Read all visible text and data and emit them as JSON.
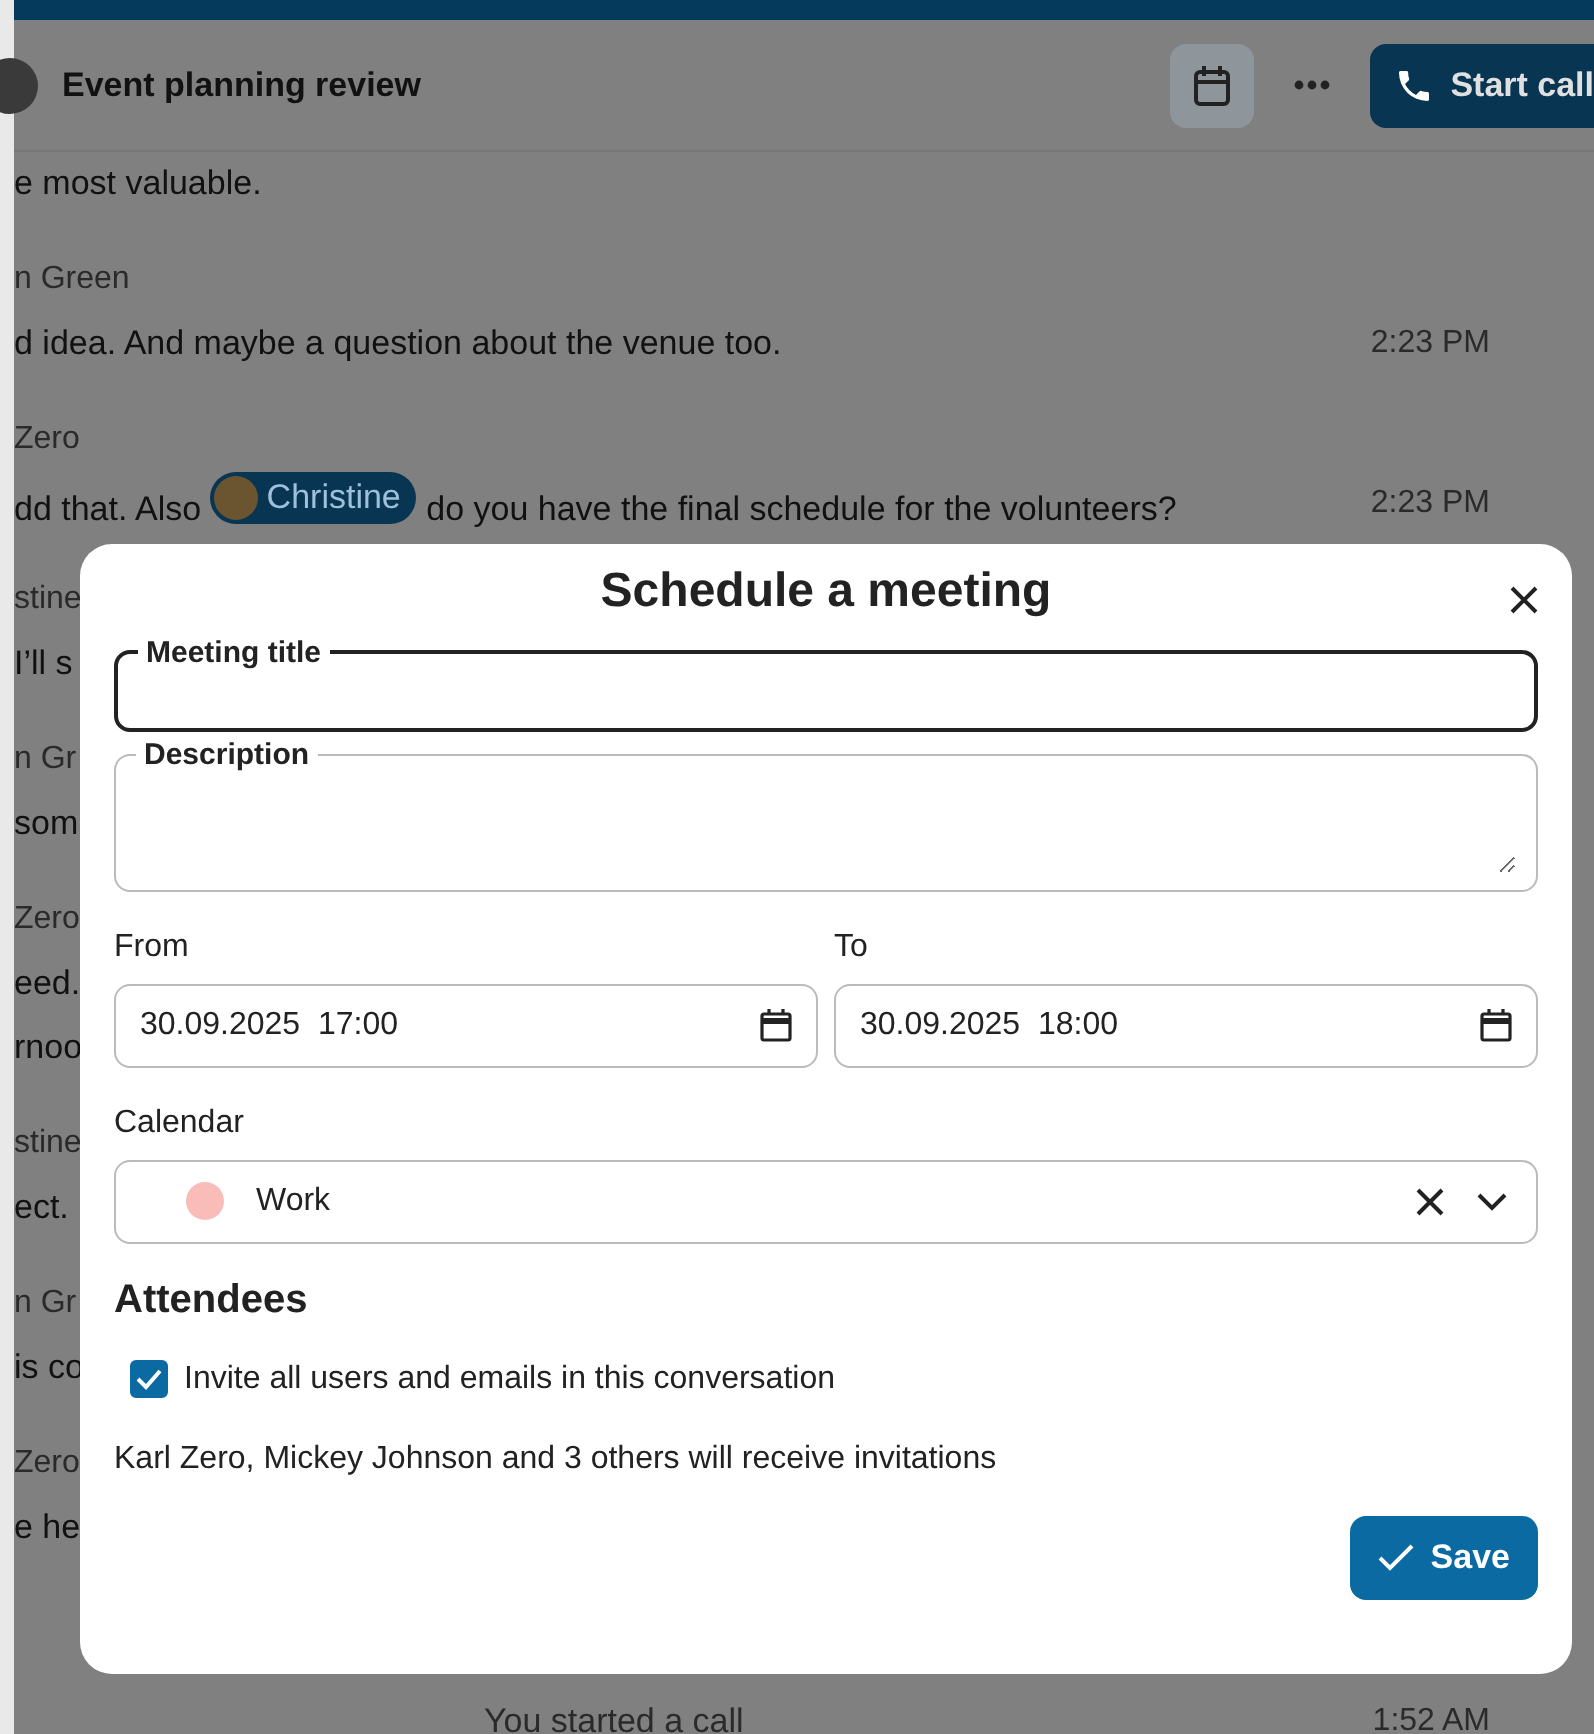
{
  "header": {
    "title": "Event planning review",
    "calendar_active": true,
    "start_call": "Start call"
  },
  "messages": [
    {
      "kind": "text",
      "text": "e most valuable."
    },
    {
      "kind": "author",
      "text": "n Green"
    },
    {
      "kind": "text",
      "text": "d idea. And maybe a question about the venue too.",
      "time": "2:23 PM"
    },
    {
      "kind": "author",
      "text": "Zero"
    },
    {
      "kind": "mention",
      "before": "dd that. Also",
      "mention": "Christine",
      "after": "do you have the final schedule for the volunteers?",
      "time": "2:23 PM"
    },
    {
      "kind": "author",
      "text": "stine"
    },
    {
      "kind": "text",
      "text": "I’ll s"
    },
    {
      "kind": "author",
      "text": "n Gr"
    },
    {
      "kind": "text",
      "text": "som"
    },
    {
      "kind": "author",
      "text": "Zero"
    },
    {
      "kind": "text",
      "text": "eed."
    },
    {
      "kind": "text",
      "text": "rnoo"
    },
    {
      "kind": "author",
      "text": "stine"
    },
    {
      "kind": "text",
      "text": "ect."
    },
    {
      "kind": "author",
      "text": "n Gr"
    },
    {
      "kind": "text",
      "text": "is co"
    },
    {
      "kind": "author",
      "text": "Zero"
    },
    {
      "kind": "text",
      "text": "e he"
    },
    {
      "kind": "system",
      "text": "You started a call",
      "time": "1:52 AM"
    }
  ],
  "dialog": {
    "title": "Schedule a meeting",
    "fields": [
      {
        "kind": "input",
        "label": "Meeting title",
        "focused": true
      },
      {
        "kind": "textarea",
        "label": "Description",
        "focused": false
      }
    ],
    "dates": [
      {
        "label": "From",
        "value": "30.09.2025  17:00"
      },
      {
        "label": "To",
        "value": "30.09.2025  18:00"
      }
    ],
    "calendar": {
      "label": "Calendar",
      "value": "Work",
      "color": "#f9bcb8"
    },
    "attendees": {
      "heading": "Attendees",
      "invite": {
        "label": "Invite all users and emails in this conversation",
        "checked": true
      },
      "note": "Karl Zero, Mickey Johnson and 3 others will receive invitations"
    },
    "save": "Save"
  }
}
